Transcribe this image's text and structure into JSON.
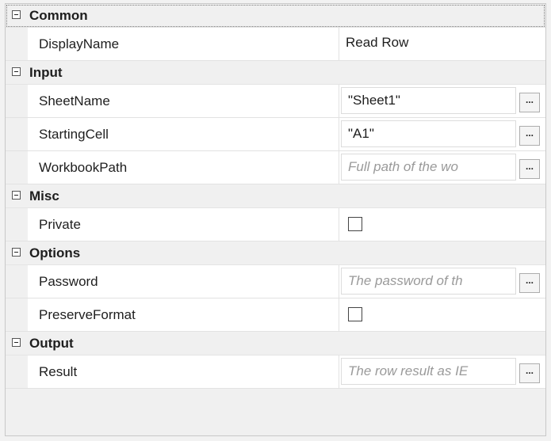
{
  "categories": [
    {
      "label": "Common",
      "properties": [
        {
          "name": "DisplayName",
          "value": "Read Row"
        }
      ]
    },
    {
      "label": "Input",
      "properties": [
        {
          "name": "SheetName",
          "value": "\"Sheet1\""
        },
        {
          "name": "StartingCell",
          "value": "\"A1\""
        },
        {
          "name": "WorkbookPath",
          "placeholder": "Full path of the wo"
        }
      ]
    },
    {
      "label": "Misc",
      "properties": [
        {
          "name": "Private",
          "checked": false
        }
      ]
    },
    {
      "label": "Options",
      "properties": [
        {
          "name": "Password",
          "placeholder": "The password of th"
        },
        {
          "name": "PreserveFormat",
          "checked": false
        }
      ]
    },
    {
      "label": "Output",
      "properties": [
        {
          "name": "Result",
          "placeholder": "The row result as IE"
        }
      ]
    }
  ],
  "ellipsis_label": "...",
  "icons": {
    "collapse": "minus-box-icon"
  }
}
